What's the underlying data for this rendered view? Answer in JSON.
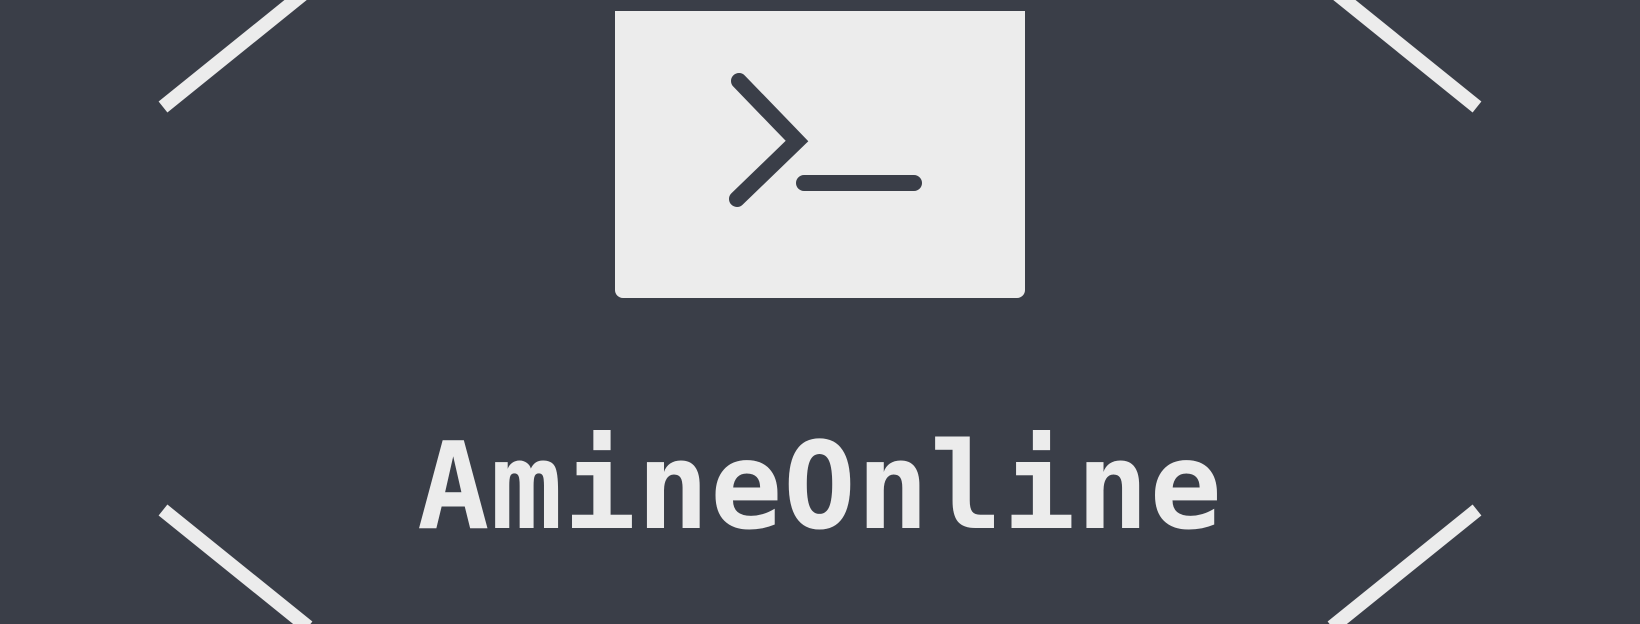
{
  "logo": {
    "brand_name": "AmineOnline",
    "icon": "terminal-prompt-icon",
    "colors": {
      "background": "#3a3e48",
      "foreground": "#ececec"
    }
  }
}
